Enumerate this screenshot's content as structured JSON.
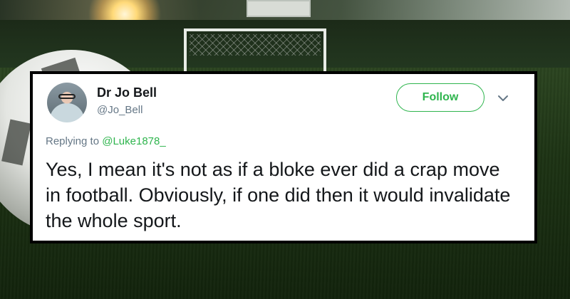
{
  "tweet": {
    "display_name": "Dr Jo Bell",
    "handle": "@Jo_Bell",
    "follow_label": "Follow",
    "replying_prefix": "Replying to",
    "replying_to": "@Luke1878_",
    "text": "Yes, I mean it's not as if a bloke ever did a crap move in football. Obviously, if one did then it would invalidate the whole sport."
  },
  "colors": {
    "accent": "#2fb54e",
    "muted": "#657786",
    "text": "#14171a"
  },
  "icons": {
    "menu": "chevron-down-icon"
  }
}
